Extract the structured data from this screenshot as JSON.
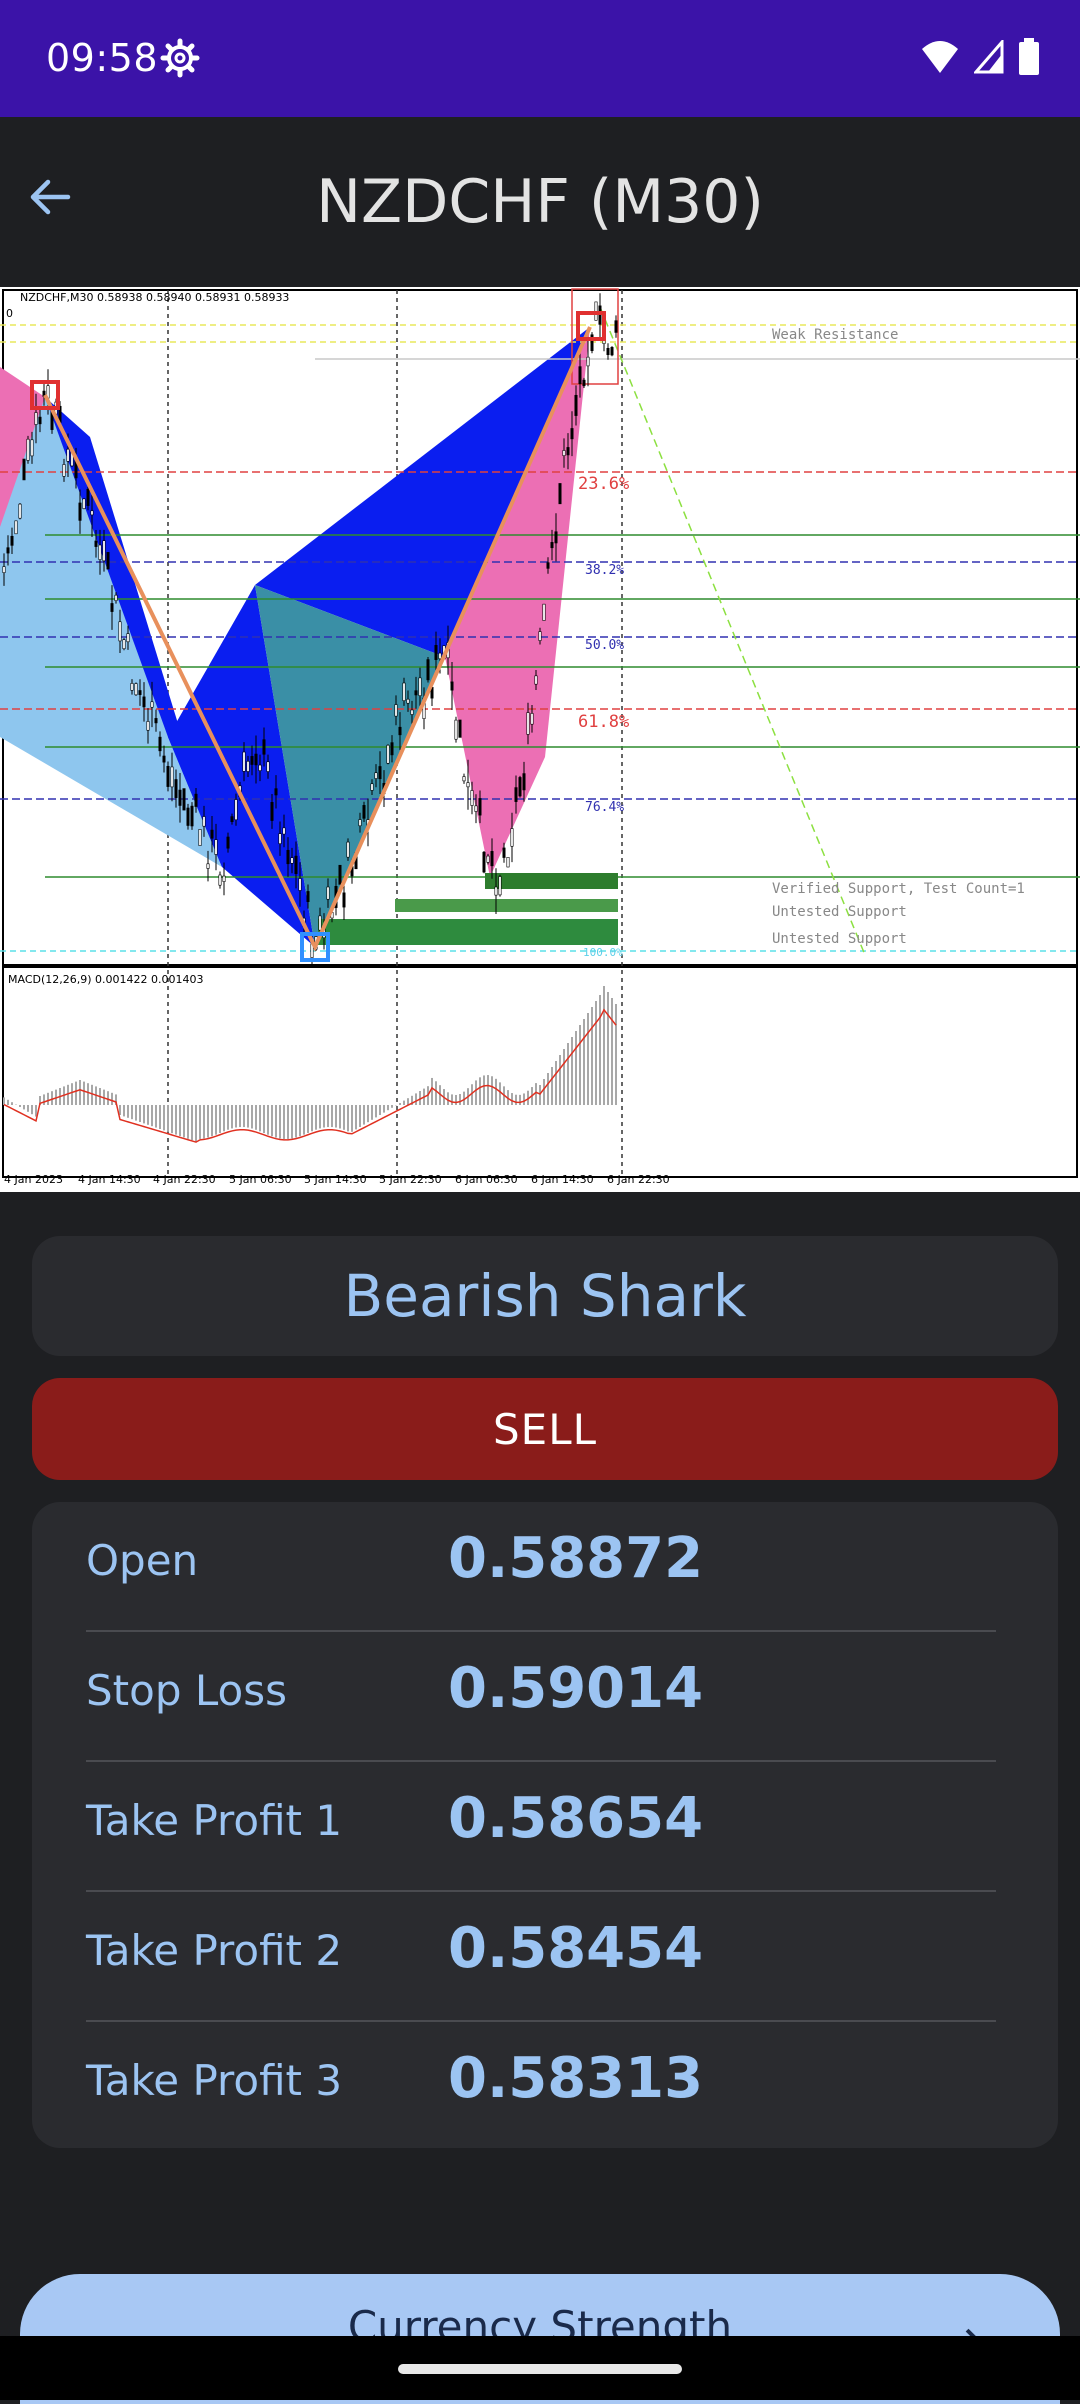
{
  "status_bar": {
    "time": "09:58"
  },
  "app_bar": {
    "title": "NZDCHF (M30)",
    "back_icon": "arrow-back-icon"
  },
  "chart": {
    "header": "NZDCHF,M30  0.58938 0.58940 0.58931 0.58933",
    "zero_label": "0",
    "fib_labels": [
      "23.6%",
      "38.2%",
      "50.0%",
      "61.8%",
      "76.4%",
      "100.0%"
    ],
    "zone_labels": [
      "Weak Resistance",
      "Verified Support, Test Count=1",
      "Untested Support",
      "Untested Support"
    ],
    "macd_label": "MACD(12,26,9) 0.001422 0.001403",
    "time_labels": [
      "4 Jan 2023",
      "4 Jan 14:30",
      "4 Jan 22:30",
      "5 Jan 06:30",
      "5 Jan 14:30",
      "5 Jan 22:30",
      "6 Jan 06:30",
      "6 Jan 14:30",
      "6 Jan 22:30"
    ],
    "colors": {
      "blue_leg": "#0a1ef0",
      "light_blue_leg": "#8ec6ee",
      "teal_leg": "#3a8fa6",
      "pink_leg": "#ec6fb4",
      "pattern_line": "#e8905c",
      "zone_green": "#2e7d2e"
    }
  },
  "pattern": {
    "name": "Bearish Shark"
  },
  "signal": {
    "label": "SELL",
    "color": "#8a1c1a"
  },
  "levels": [
    {
      "label": "Open",
      "value": "0.58872"
    },
    {
      "label": "Stop Loss",
      "value": "0.59014"
    },
    {
      "label": "Take Profit 1",
      "value": "0.58654"
    },
    {
      "label": "Take Profit 2",
      "value": "0.58454"
    },
    {
      "label": "Take Profit 3",
      "value": "0.58313"
    }
  ],
  "cta": {
    "label": "Currency Strength",
    "icon": "arrow-forward-icon"
  }
}
